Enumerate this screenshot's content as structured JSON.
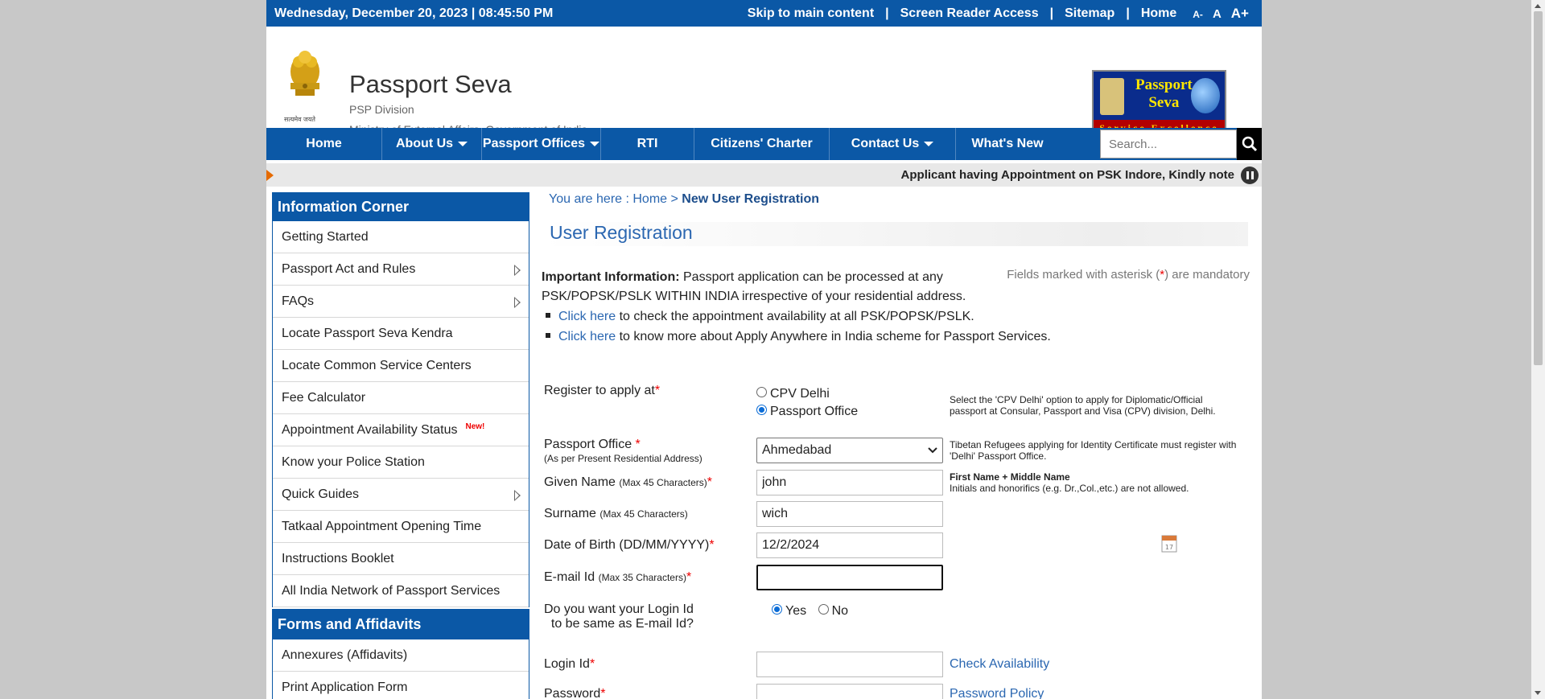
{
  "topbar": {
    "datetime": "Wednesday,  December  20, 2023 | 08:45:50 PM",
    "skip": "Skip to main content",
    "reader": "Screen Reader Access",
    "sitemap": "Sitemap",
    "home": "Home",
    "font_small": "A-",
    "font_normal": "A",
    "font_large": "A+",
    "sep": "|"
  },
  "header": {
    "title": "Passport Seva",
    "division": "PSP Division",
    "ministry": "Ministry of External Affairs, Government of India",
    "emblem_caption": "सत्यमेव जयते",
    "logo_line1": "Passport",
    "logo_line2": "Seva",
    "logo_tagline": "Service Excellence"
  },
  "nav": {
    "items": [
      {
        "label": "Home"
      },
      {
        "label": "About Us"
      },
      {
        "label": "Passport Offices"
      },
      {
        "label": "RTI"
      },
      {
        "label": "Citizens' Charter"
      },
      {
        "label": "Contact Us"
      },
      {
        "label": "What's New"
      }
    ],
    "search_placeholder": "Search..."
  },
  "marquee": {
    "text": "Applicant having Appointment on PSK Indore, Kindly note"
  },
  "sidebar": {
    "info_title": "Information Corner",
    "items": [
      {
        "label": "Getting Started"
      },
      {
        "label": "Passport Act and Rules"
      },
      {
        "label": "FAQs"
      },
      {
        "label": "Locate Passport Seva Kendra"
      },
      {
        "label": "Locate Common Service Centers"
      },
      {
        "label": "Fee Calculator"
      },
      {
        "label": "Appointment Availability Status"
      },
      {
        "label": "Know your Police Station"
      },
      {
        "label": "Quick Guides"
      },
      {
        "label": "Tatkaal Appointment Opening Time"
      },
      {
        "label": "Instructions Booklet"
      },
      {
        "label": "All India Network of Passport Services"
      }
    ],
    "new_badge": "New!",
    "forms_title": "Forms and Affidavits",
    "forms_items": [
      {
        "label": "Annexures (Affidavits)"
      },
      {
        "label": "Print Application Form"
      }
    ]
  },
  "main": {
    "crumb_prefix": "You are here : ",
    "crumb_home": "Home",
    "crumb_sep": " > ",
    "crumb_current": "New User Registration",
    "page_title": "User Registration",
    "info_bold": "Important Information:",
    "info_text": " Passport application can be processed at any PSK/POPSK/PSLK WITHIN INDIA irrespective of your residential address.",
    "mandatory_pre": "Fields marked with asterisk (",
    "mandatory_ast": "*",
    "mandatory_post": ") are mandatory",
    "bullet1_link": "Click here",
    "bullet1_text": " to check the appointment availability at all PSK/POPSK/PSLK.",
    "bullet2_link": "Click here",
    "bullet2_text": " to know more about Apply Anywhere in India scheme for Passport Services."
  },
  "form": {
    "register_label": "Register to apply at",
    "opt_cpv": "CPV Delhi",
    "opt_po": "Passport Office",
    "cpv_note": "Select the 'CPV Delhi' option to apply for Diplomatic/Official passport at Consular, Passport and Visa (CPV) division, Delhi.",
    "po_label": "Passport Office ",
    "po_sub": "(As per Present Residential Address)",
    "po_value": "Ahmedabad",
    "po_note": "Tibetan Refugees applying for Identity Certificate must register with 'Delhi' Passport Office.",
    "given_label": "Given Name ",
    "given_sub": "(Max 45 Characters)",
    "given_value": "john",
    "given_note_bold": "First Name + Middle Name",
    "given_note": "Initials and honorifics (e.g. Dr.,Col.,etc.) are not allowed.",
    "surname_label": "Surname ",
    "surname_sub": "(Max 45 Characters)",
    "surname_value": "wich",
    "dob_label": "Date of Birth (DD/MM/YYYY)",
    "dob_value": "12/2/2024",
    "email_label": "E-mail Id ",
    "email_sub": "(Max 35 Characters)",
    "email_value": "",
    "same_label_1": "Do you want your Login Id",
    "same_label_2": "to be same as E-mail Id?",
    "yes": "Yes",
    "no": "No",
    "login_label": "Login Id",
    "login_value": "",
    "check_availability": "Check Availability",
    "password_label": "Password",
    "password_policy": "Password Policy",
    "ast": "*"
  },
  "colors": {
    "brand_blue": "#0b58a6",
    "link_blue": "#2b67b1",
    "required_red": "#e00000"
  }
}
